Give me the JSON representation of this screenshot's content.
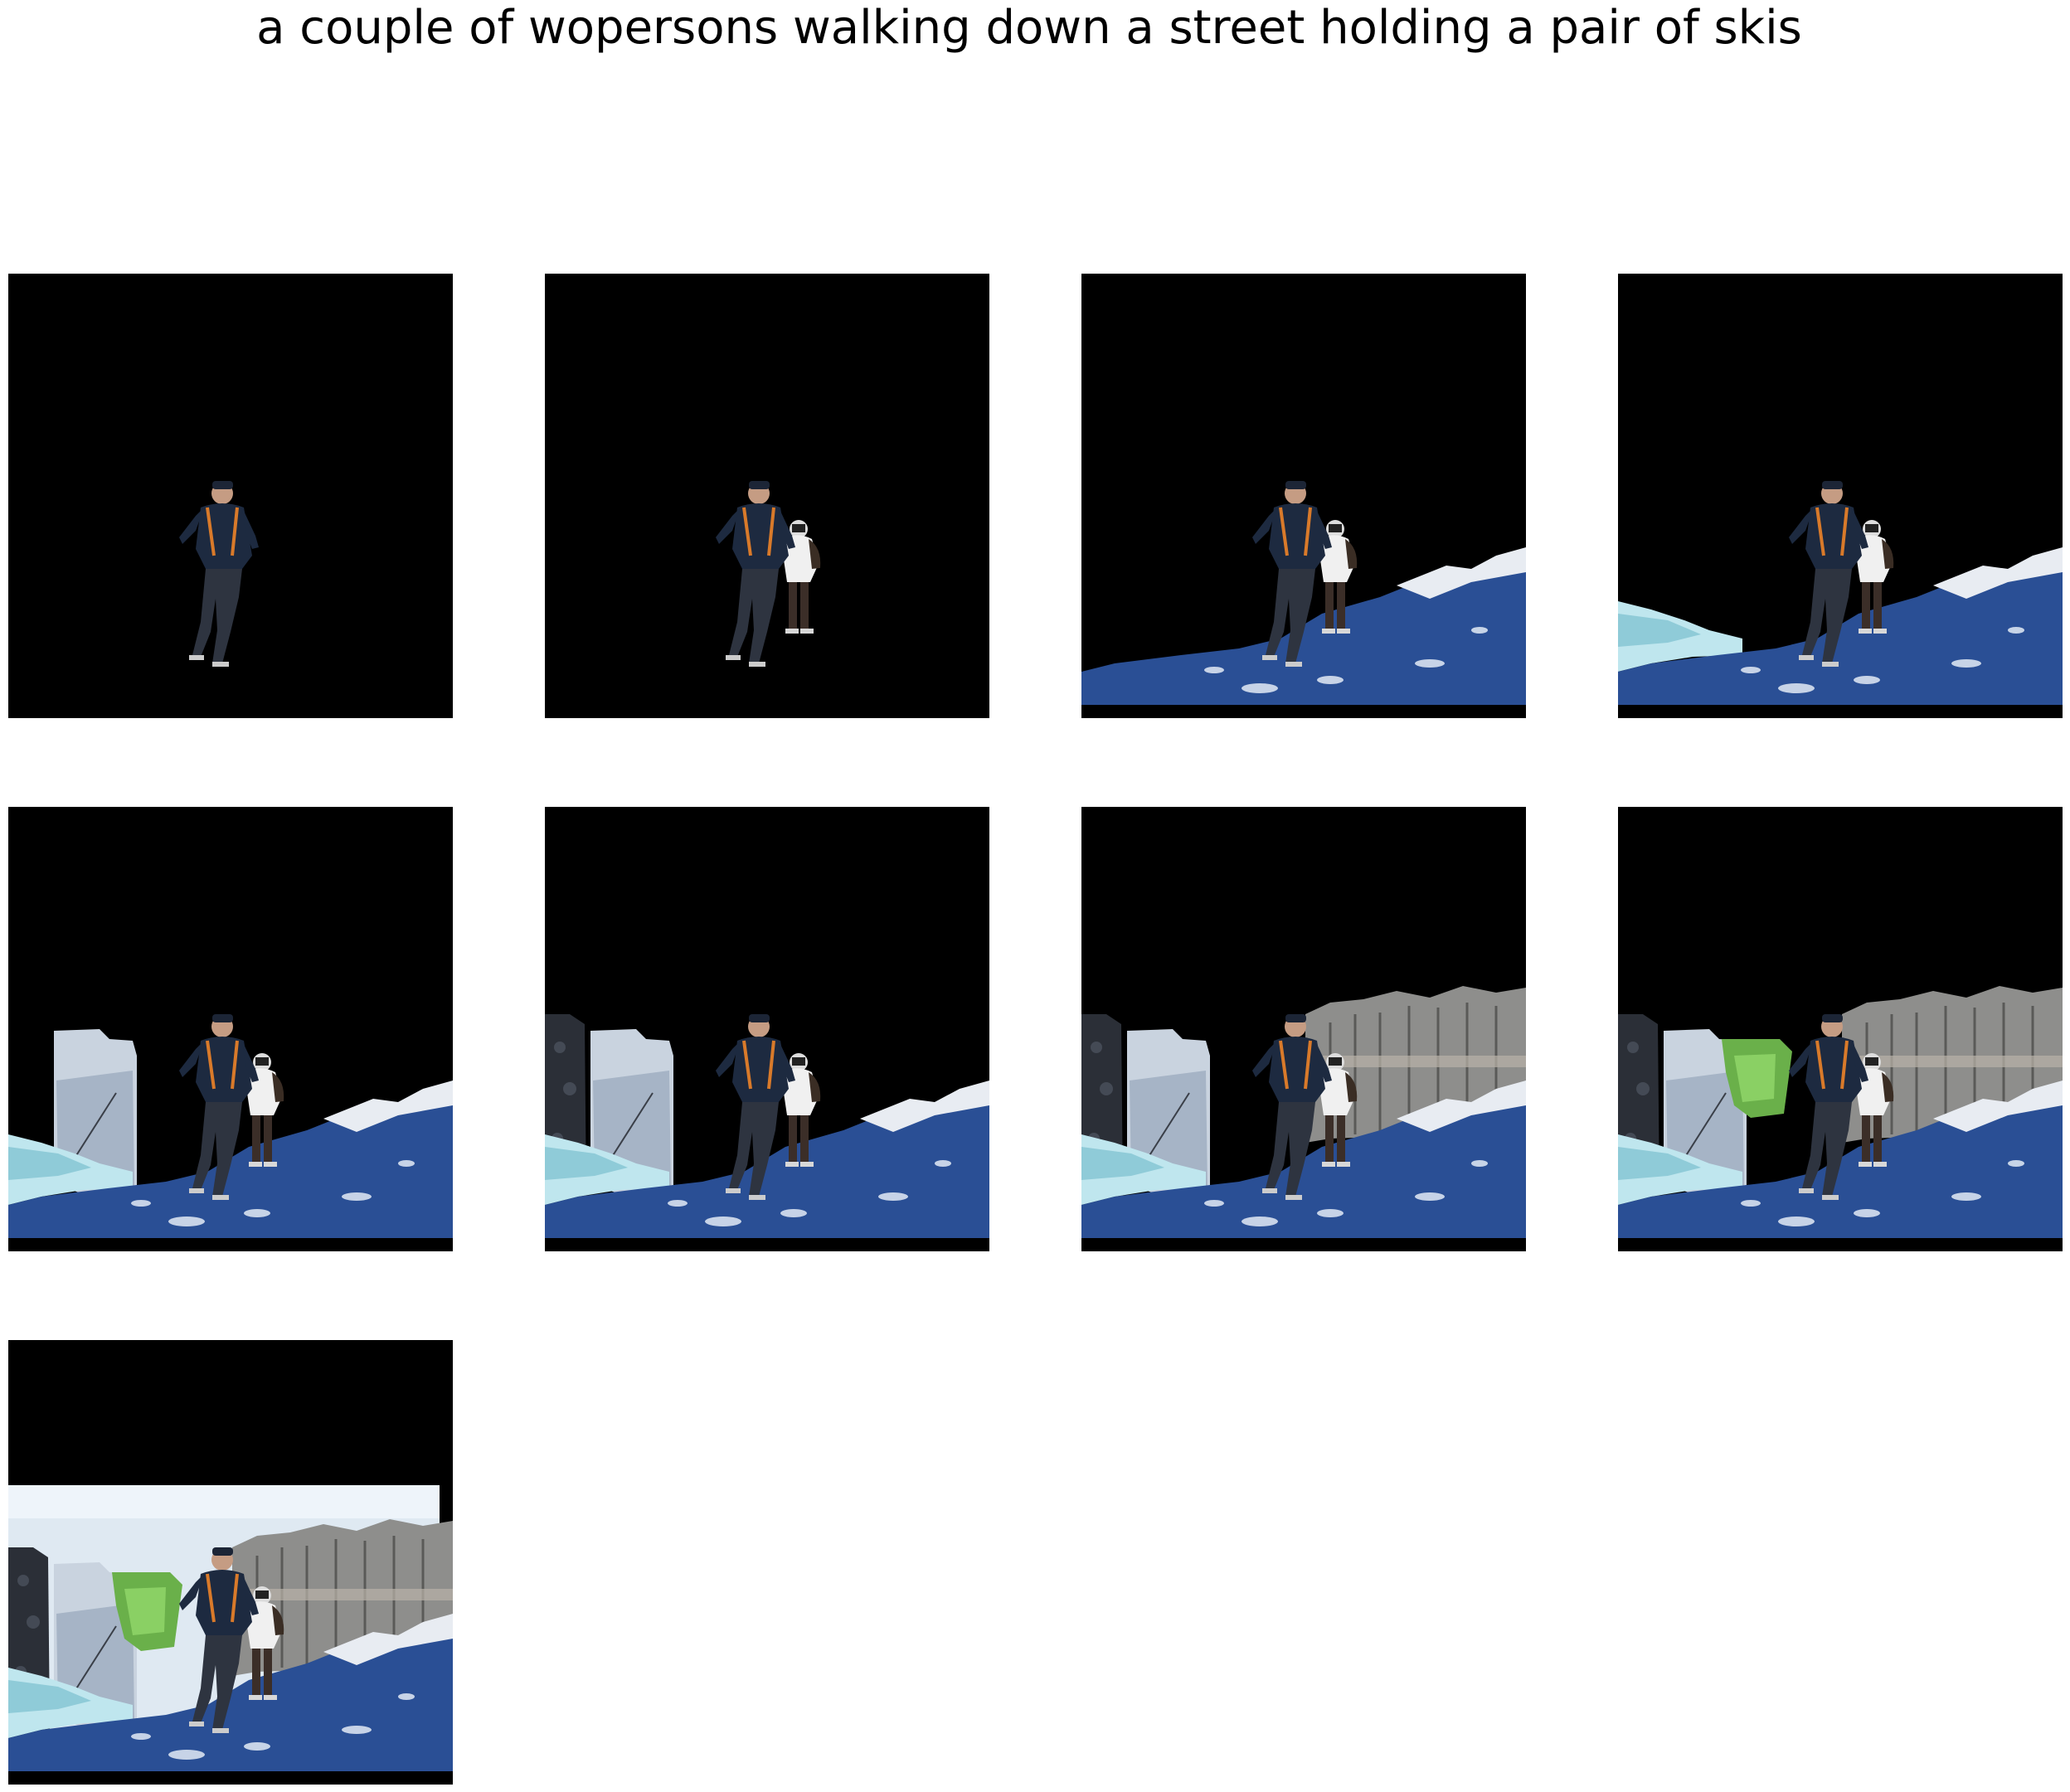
{
  "figure": {
    "title": "a couple of wopersons walking down a street holding a pair of skis"
  },
  "panels": [
    {
      "step": 1,
      "layers": [
        "person-man"
      ]
    },
    {
      "step": 2,
      "layers": [
        "person-man",
        "person-woman"
      ]
    },
    {
      "step": 3,
      "layers": [
        "person-man",
        "person-woman",
        "snow-slope"
      ]
    },
    {
      "step": 4,
      "layers": [
        "person-man",
        "person-woman",
        "snow-slope",
        "ice-left"
      ]
    },
    {
      "step": 5,
      "layers": [
        "person-man",
        "person-woman",
        "snow-slope",
        "ice-left",
        "frozen-road"
      ]
    },
    {
      "step": 6,
      "layers": [
        "person-man",
        "person-woman",
        "snow-slope",
        "ice-left",
        "frozen-road",
        "dark-rock"
      ]
    },
    {
      "step": 7,
      "layers": [
        "person-man",
        "person-woman",
        "snow-slope",
        "ice-left",
        "frozen-road",
        "dark-rock",
        "winter-trees"
      ]
    },
    {
      "step": 8,
      "layers": [
        "person-man",
        "person-woman",
        "snow-slope",
        "ice-left",
        "frozen-road",
        "dark-rock",
        "winter-trees",
        "green-grass"
      ]
    },
    {
      "step": 9,
      "layers": [
        "person-man",
        "person-woman",
        "snow-slope",
        "ice-left",
        "frozen-road",
        "dark-rock",
        "winter-trees",
        "green-grass",
        "sky"
      ]
    }
  ]
}
